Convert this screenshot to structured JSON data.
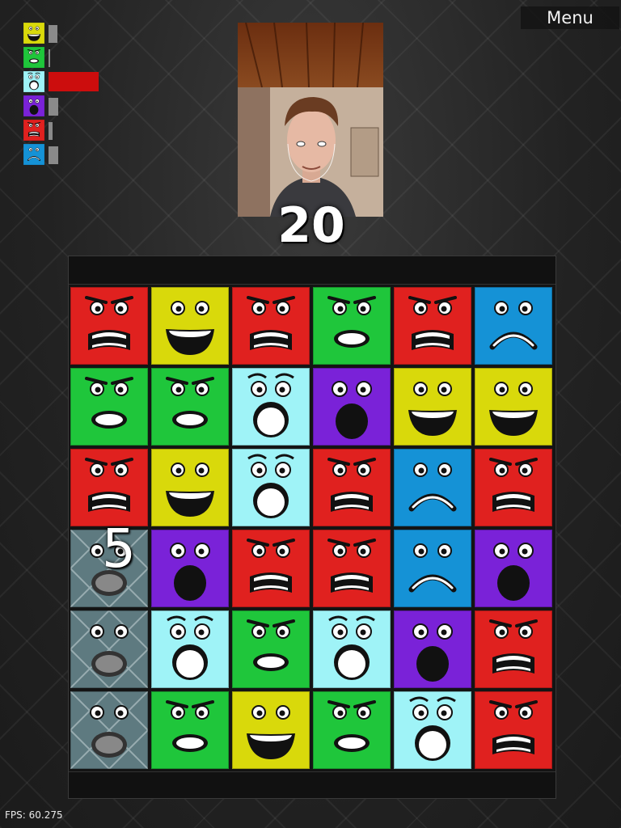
{
  "menu": {
    "label": "Menu"
  },
  "stats": [
    {
      "face": "happy",
      "level": 0.18
    },
    {
      "face": "surprised",
      "level": 0.0
    },
    {
      "face": "shocked",
      "level": 1.0
    },
    {
      "face": "scared",
      "level": 0.2
    },
    {
      "face": "angry",
      "level": 0.08
    },
    {
      "face": "sad",
      "level": 0.2
    }
  ],
  "camera": {
    "icon": "webcam-face-feed"
  },
  "score": "20",
  "combo": "5",
  "fps": "FPS: 60.275",
  "colors": {
    "angry": "#e0211f",
    "happy": "#d9d90b",
    "surprised": "#1fc63b",
    "shocked": "#9ff3f7",
    "scared": "#7a22d8",
    "sad": "#1592d6",
    "stone": "#5e7a80",
    "active_bar": "#cc0d0d"
  },
  "board": [
    [
      "angry",
      "happy",
      "angry",
      "surprised",
      "angry",
      "sad"
    ],
    [
      "surprised",
      "surprised",
      "shocked",
      "scared",
      "happy",
      "happy"
    ],
    [
      "angry",
      "happy",
      "shocked",
      "angry",
      "sad",
      "angry"
    ],
    [
      "stone",
      "scared",
      "angry",
      "angry",
      "sad",
      "scared"
    ],
    [
      "stone",
      "shocked",
      "surprised",
      "shocked",
      "scared",
      "angry"
    ],
    [
      "stone",
      "surprised",
      "happy",
      "surprised",
      "shocked",
      "angry"
    ]
  ]
}
